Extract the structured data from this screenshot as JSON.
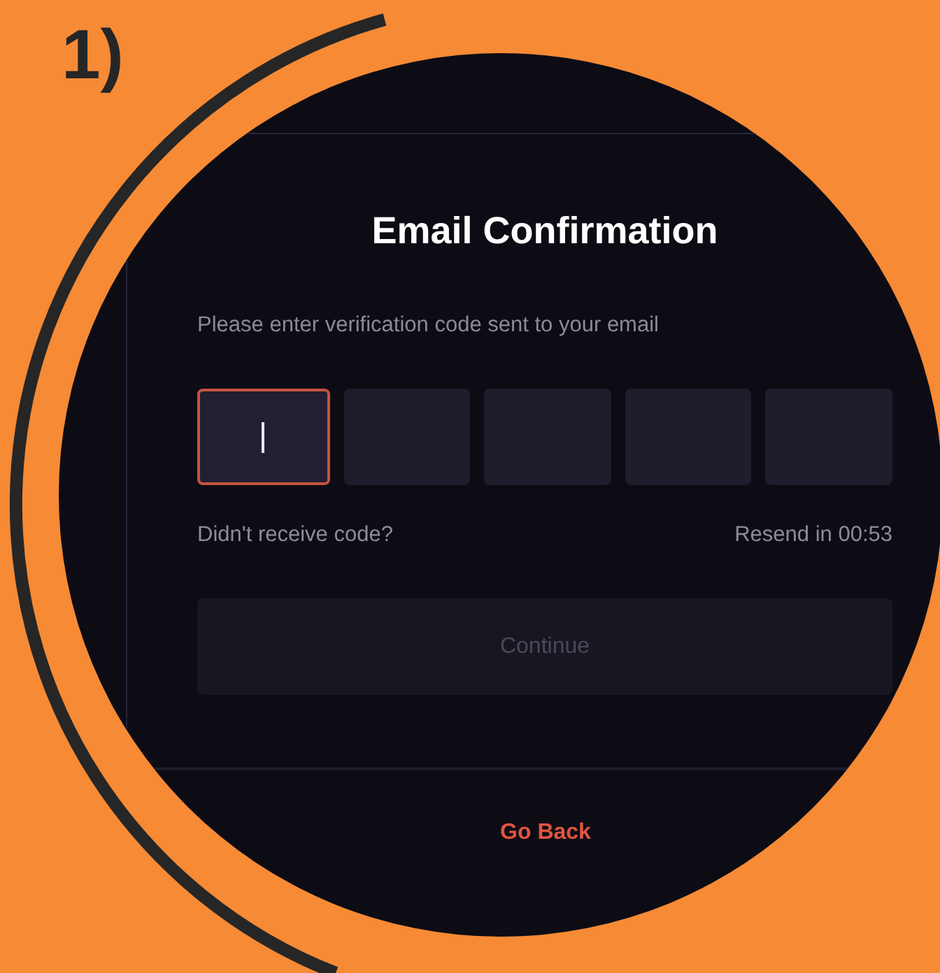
{
  "step_label": "1)",
  "dialog": {
    "title": "Email Confirmation",
    "instruction": "Please enter verification code sent to your email",
    "code_fields": [
      {
        "focused": true
      },
      {
        "focused": false
      },
      {
        "focused": false
      },
      {
        "focused": false
      },
      {
        "focused": false
      }
    ],
    "no_code_text": "Didn't receive code?",
    "resend_timer": "Resend in 00:53",
    "continue_button": {
      "label": "Continue",
      "disabled": true
    }
  },
  "go_back_link": "Go Back"
}
